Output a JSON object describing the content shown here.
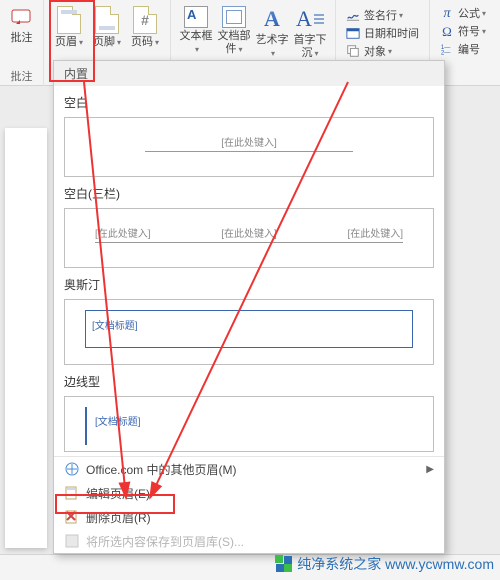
{
  "ribbon": {
    "groups": {
      "annotLabel": "批注",
      "headerFooter": {
        "header": "页眉",
        "footer": "页脚",
        "pageNum": "页码"
      },
      "text": {
        "textbox": "文本框",
        "parts": "文档部件",
        "wordart": "艺术字",
        "dropcap": "首字下沉"
      },
      "misc": {
        "sigline": "签名行",
        "datetime": "日期和时间",
        "object": "对象"
      },
      "equation": "公式",
      "symbol": "符号",
      "number": "编号"
    }
  },
  "dropdown": {
    "headerLabel": "内置",
    "templates": [
      {
        "title": "空白",
        "sample": "[在此处键入]"
      },
      {
        "title": "空白(三栏)",
        "sample": "[在此处键入]"
      },
      {
        "title": "奥斯汀",
        "sample": "[文档标题]"
      },
      {
        "title": "边线型",
        "sample": "[文档标题]"
      }
    ],
    "footer": {
      "office": "Office.com 中的其他页眉(M)",
      "edit": "编辑页眉(E)",
      "remove": "删除页眉(R)",
      "save": "将所选内容保存到页眉库(S)..."
    }
  },
  "watermark": "纯净系统之家 www.ycwmw.com"
}
